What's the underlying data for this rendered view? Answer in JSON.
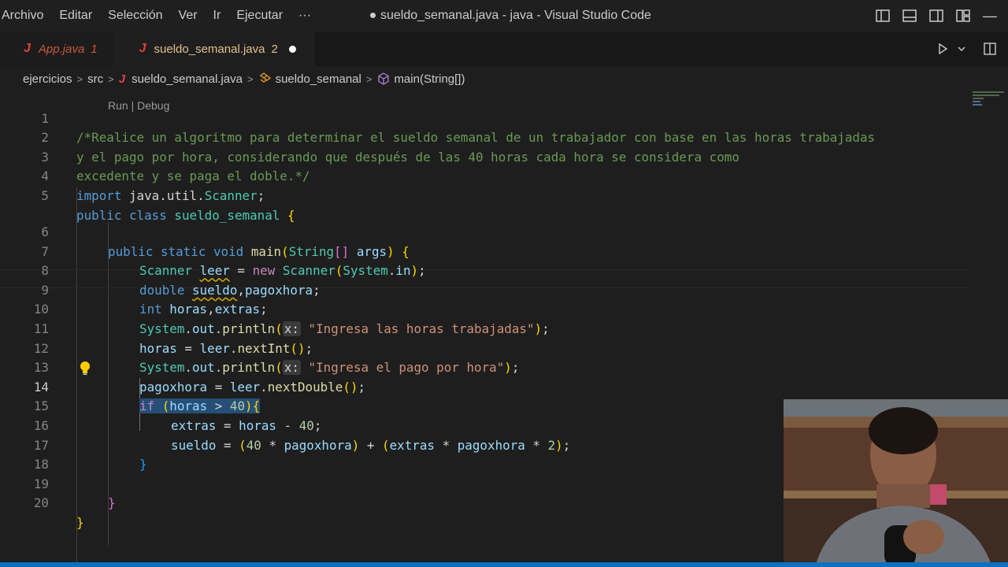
{
  "menu": [
    "Archivo",
    "Editar",
    "Selección",
    "Ver",
    "Ir",
    "Ejecutar",
    "···"
  ],
  "window_title": "sueldo_semanal.java - java - Visual Studio Code",
  "tabs": [
    {
      "icon": "J",
      "label": "App.java",
      "count": "1",
      "active": false
    },
    {
      "icon": "J",
      "label": "sueldo_semanal.java",
      "count": "2",
      "active": true,
      "modified": true
    }
  ],
  "breadcrumb": {
    "folder1": "ejercicios",
    "folder2": "src",
    "file_icon": "J",
    "file": "sueldo_semanal.java",
    "class": "sueldo_semanal",
    "method": "main(String[])"
  },
  "codelens": "Run | Debug",
  "editor": {
    "current_line": 14,
    "line_numbers": [
      "1",
      "2",
      "3",
      "4",
      "5",
      "6",
      "7",
      "8",
      "9",
      "10",
      "11",
      "12",
      "13",
      "14",
      "15",
      "16",
      "17",
      "18",
      "19",
      "20"
    ],
    "lines": [
      "/*Realice un algoritmo para determinar el sueldo semanal de un trabajador con base en las horas trabajadas",
      "y el pago por hora, considerando que después de las 40 horas cada hora se considera como",
      "excedente y se paga el doble.*/",
      "import java.util.Scanner;",
      "public class sueldo_semanal {",
      "public static void main(String[] args) {",
      "Scanner leer = new Scanner(System.in);",
      "double sueldo,pagoxhora;",
      "int horas,extras;",
      "System.out.println(x: \"Ingresa las horas trabajadas\");",
      "horas = leer.nextInt();",
      "System.out.println(x: \"Ingresa el pago por hora\");",
      "pagoxhora = leer.nextDouble();",
      "if (horas > 40){",
      "extras = horas - 40;",
      "sueldo = (40 * pagoxhora) + (extras * pagoxhora * 2);",
      "}",
      "",
      "}",
      "}"
    ]
  },
  "colors": {
    "keyword": "#569cd6",
    "control": "#c586c0",
    "type": "#4ec9b0",
    "function": "#dcdcaa",
    "variable": "#9cdcfe",
    "string": "#ce9178",
    "number": "#b5cea8",
    "comment": "#6a9955",
    "accent": "#0e70c0"
  }
}
